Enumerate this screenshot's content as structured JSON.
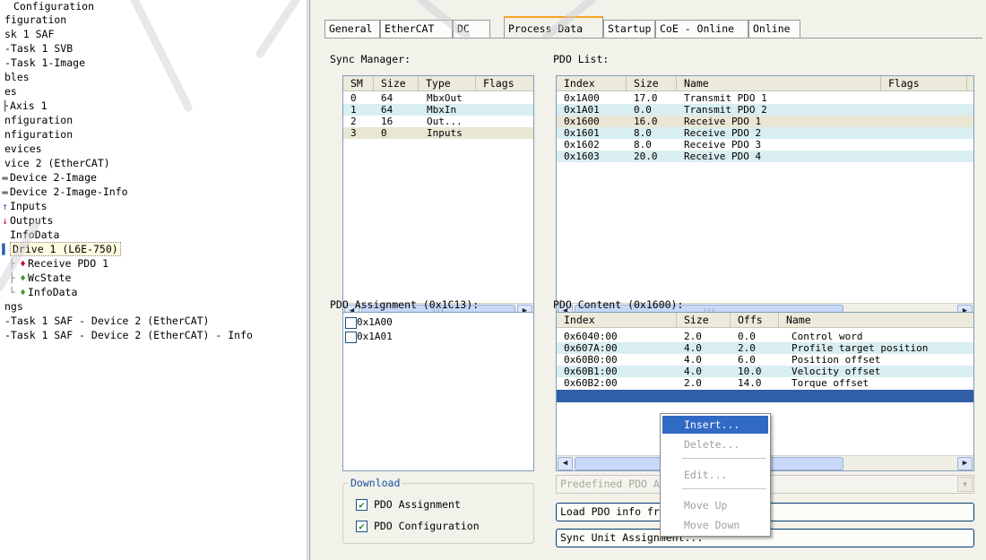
{
  "tree": {
    "items": [
      {
        "label": "Configuration",
        "icon": "config-icon"
      },
      {
        "label": "figuration",
        "icon": "config-icon"
      },
      {
        "label": "sk 1 SAF",
        "icon": "task-icon"
      },
      {
        "label": "-Task 1 SVB",
        "icon": "task-icon"
      },
      {
        "label": "-Task 1-Image",
        "icon": "image-icon"
      },
      {
        "label": "bles",
        "icon": "table-icon"
      },
      {
        "label": "es",
        "icon": "axis-icon"
      },
      {
        "label": "Axis 1",
        "icon": "axis-icon"
      },
      {
        "label": "nfiguration",
        "icon": "config-icon"
      },
      {
        "label": "nfiguration",
        "icon": "config-icon"
      },
      {
        "label": "evices",
        "icon": "device-icon"
      },
      {
        "label": "vice 2 (EtherCAT)",
        "icon": "device-icon"
      },
      {
        "label": "Device 2-Image",
        "icon": "image-icon"
      },
      {
        "label": "Device 2-Image-Info",
        "icon": "image-icon"
      },
      {
        "label": "Inputs",
        "icon": "inputs-icon"
      },
      {
        "label": "Outputs",
        "icon": "outputs-icon"
      },
      {
        "label": "InfoData",
        "icon": "info-icon"
      },
      {
        "label": "Drive 1 (L6E-750)",
        "icon": "drive-icon"
      },
      {
        "label": "Receive PDO 1",
        "icon": "receive-pdo-icon"
      },
      {
        "label": "WcState",
        "icon": "wcstate-icon"
      },
      {
        "label": "InfoData",
        "icon": "info-icon"
      },
      {
        "label": "ngs",
        "icon": "mapping-icon"
      },
      {
        "label": "-Task 1 SAF - Device 2 (EtherCAT)",
        "icon": "mapping-icon"
      },
      {
        "label": "-Task 1 SAF - Device 2 (EtherCAT) - Info",
        "icon": "mapping-icon"
      }
    ]
  },
  "tabs": [
    "General",
    "EtherCAT",
    "DC",
    "Process Data",
    "Startup",
    "CoE - Online",
    "Online"
  ],
  "active_tab": "Process Data",
  "sync_manager": {
    "label": "Sync Manager:",
    "columns": [
      "SM",
      "Size",
      "Type",
      "Flags"
    ],
    "rows": [
      [
        "0",
        "64",
        "MbxOut",
        ""
      ],
      [
        "1",
        "64",
        "MbxIn",
        ""
      ],
      [
        "2",
        "16",
        "Out...",
        ""
      ],
      [
        "3",
        "0",
        "Inputs",
        ""
      ]
    ]
  },
  "pdo_list": {
    "label": "PDO List:",
    "columns": [
      "Index",
      "Size",
      "Name",
      "Flags"
    ],
    "rows": [
      [
        "0x1A00",
        "17.0",
        "Transmit PDO 1",
        ""
      ],
      [
        "0x1A01",
        "0.0",
        "Transmit PDO 2",
        ""
      ],
      [
        "0x1600",
        "16.0",
        "Receive PDO 1",
        ""
      ],
      [
        "0x1601",
        "8.0",
        "Receive PDO 2",
        ""
      ],
      [
        "0x1602",
        "8.0",
        "Receive PDO 3",
        ""
      ],
      [
        "0x1603",
        "20.0",
        "Receive PDO 4",
        ""
      ]
    ]
  },
  "pdo_assignment": {
    "label": "PDO Assignment (0x1C13):",
    "items": [
      {
        "label": "0x1A00",
        "checked": false
      },
      {
        "label": "0x1A01",
        "checked": false
      }
    ]
  },
  "pdo_content": {
    "label": "PDO Content (0x1600):",
    "columns": [
      "Index",
      "Size",
      "Offs",
      "Name"
    ],
    "rows": [
      [
        "0x6040:00",
        "2.0",
        "0.0",
        "Control word"
      ],
      [
        "0x607A:00",
        "4.0",
        "2.0",
        "Profile target position"
      ],
      [
        "0x60B0:00",
        "4.0",
        "6.0",
        "Position offset"
      ],
      [
        "0x60B1:00",
        "4.0",
        "10.0",
        "Velocity offset"
      ],
      [
        "0x60B2:00",
        "2.0",
        "14.0",
        "Torque offset"
      ]
    ]
  },
  "download": {
    "title": "Download",
    "pdo_assignment": {
      "label": "PDO Assignment",
      "checked": true
    },
    "pdo_configuration": {
      "label": "PDO Configuration",
      "checked": true
    }
  },
  "predefined_combo": {
    "value": "Predefined PDO A"
  },
  "buttons": {
    "load_pdo": "Load PDO info fr",
    "sync_unit": "Sync Unit Assignment..."
  },
  "context_menu": {
    "items": [
      {
        "label": "Insert...",
        "enabled": true
      },
      {
        "label": "Delete...",
        "enabled": false
      },
      {
        "label": "Edit...",
        "enabled": false
      },
      {
        "label": "Move Up",
        "enabled": false
      },
      {
        "label": "Move Down",
        "enabled": false
      }
    ]
  },
  "colors": {
    "tab_accent": "#f5a623",
    "selection": "#2f5fa7",
    "stripe": "#d9eef0",
    "menu_hover": "#316ac5"
  }
}
